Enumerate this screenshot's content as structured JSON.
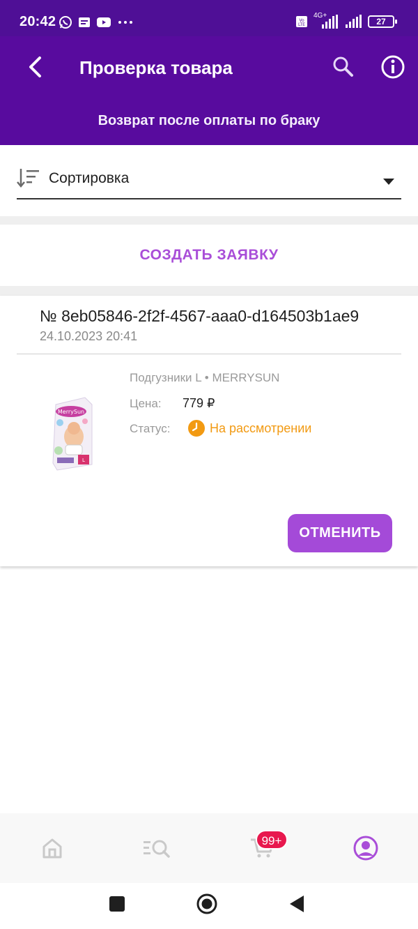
{
  "status_bar": {
    "time": "20:42",
    "battery": "27",
    "network": "4G+",
    "icons": [
      "whatsapp-icon",
      "message-icon",
      "youtube-icon",
      "more-dots-icon",
      "volte-icon",
      "signal-icon",
      "signal-icon-2",
      "battery-icon"
    ]
  },
  "header": {
    "title": "Проверка товара",
    "subtitle": "Возврат после оплаты по браку",
    "icons": [
      "back-arrow-icon",
      "search-icon",
      "info-icon"
    ]
  },
  "sort": {
    "label": "Сортировка"
  },
  "actions": {
    "create_label": "СОЗДАТЬ ЗАЯВКУ"
  },
  "request": {
    "number": "№ 8eb05846-2f2f-4567-aaa0-d164503b1ae9",
    "date": "24.10.2023 20:41",
    "product_name": "Подгузники L • MERRYSUN",
    "price_label": "Цена:",
    "price_value": "779 ₽",
    "status_label": "Статус:",
    "status_value": "На рассмотрении",
    "cancel_label": "ОТМЕНИТЬ"
  },
  "bottom_nav": {
    "items": [
      "home-icon",
      "catalog-search-icon",
      "cart-icon",
      "profile-icon"
    ],
    "cart_badge": "99+"
  },
  "colors": {
    "header_bg": "#580b9e",
    "accent": "#a94ed8",
    "status_orange": "#f29a12",
    "badge_red": "#e8184e"
  }
}
